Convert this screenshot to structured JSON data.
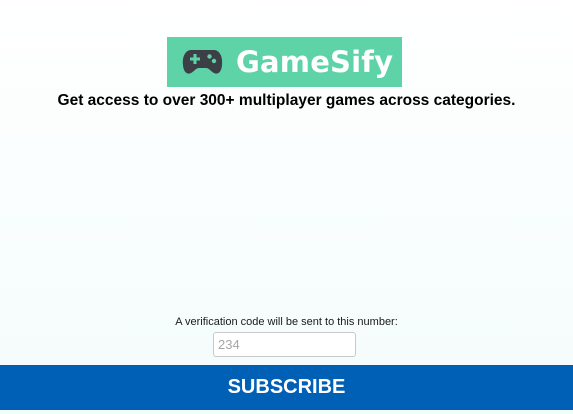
{
  "logo": {
    "text": "GameSify",
    "icon": "gamepad-icon",
    "background_color": "#5dd3a7"
  },
  "tagline": "Get access to over 300+ multiplayer games across categories.",
  "verification": {
    "label": "A verification code will be sent to this number:",
    "input_value": "",
    "input_placeholder": "234"
  },
  "subscribe": {
    "label": "SUBSCRIBE",
    "color": "#0060b6"
  }
}
